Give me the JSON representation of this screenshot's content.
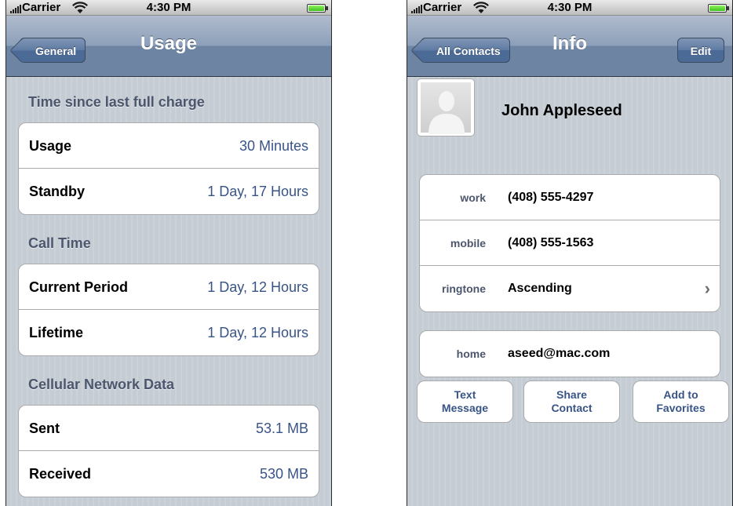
{
  "left": {
    "statusbar": {
      "carrier": "Carrier",
      "time": "4:30 PM"
    },
    "navbar": {
      "back_label": "General",
      "title": "Usage"
    },
    "sections": [
      {
        "title": "Time since last full charge",
        "rows": [
          {
            "label": "Usage",
            "value": "30 Minutes"
          },
          {
            "label": "Standby",
            "value": "1 Day, 17 Hours"
          }
        ]
      },
      {
        "title": "Call Time",
        "rows": [
          {
            "label": "Current Period",
            "value": "1 Day, 12 Hours"
          },
          {
            "label": "Lifetime",
            "value": "1 Day, 12 Hours"
          }
        ]
      },
      {
        "title": "Cellular Network Data",
        "rows": [
          {
            "label": "Sent",
            "value": "53.1 MB"
          },
          {
            "label": "Received",
            "value": "530 MB"
          }
        ]
      }
    ]
  },
  "right": {
    "statusbar": {
      "carrier": "Carrier",
      "time": "4:30 PM"
    },
    "navbar": {
      "back_label": "All Contacts",
      "title": "Info",
      "edit_label": "Edit"
    },
    "contact": {
      "name": "John Appleseed",
      "phones": [
        {
          "label": "work",
          "value": "(408) 555-4297"
        },
        {
          "label": "mobile",
          "value": "(408) 555-1563"
        },
        {
          "label": "ringtone",
          "value": "Ascending",
          "chevron": "›"
        }
      ],
      "emails": [
        {
          "label": "home",
          "value": "aseed@mac.com"
        }
      ]
    },
    "actions": [
      {
        "line1": "Text",
        "line2": "Message"
      },
      {
        "line1": "Share",
        "line2": "Contact"
      },
      {
        "line1": "Add to",
        "line2": "Favorites"
      }
    ]
  },
  "colors": {
    "accent_text": "#385487",
    "section_title": "#4c566c",
    "navbar": "#6d84a2"
  },
  "icons": [
    "signal-icon",
    "wifi-icon",
    "battery-icon",
    "chevron-right-icon",
    "avatar-placeholder-icon"
  ]
}
